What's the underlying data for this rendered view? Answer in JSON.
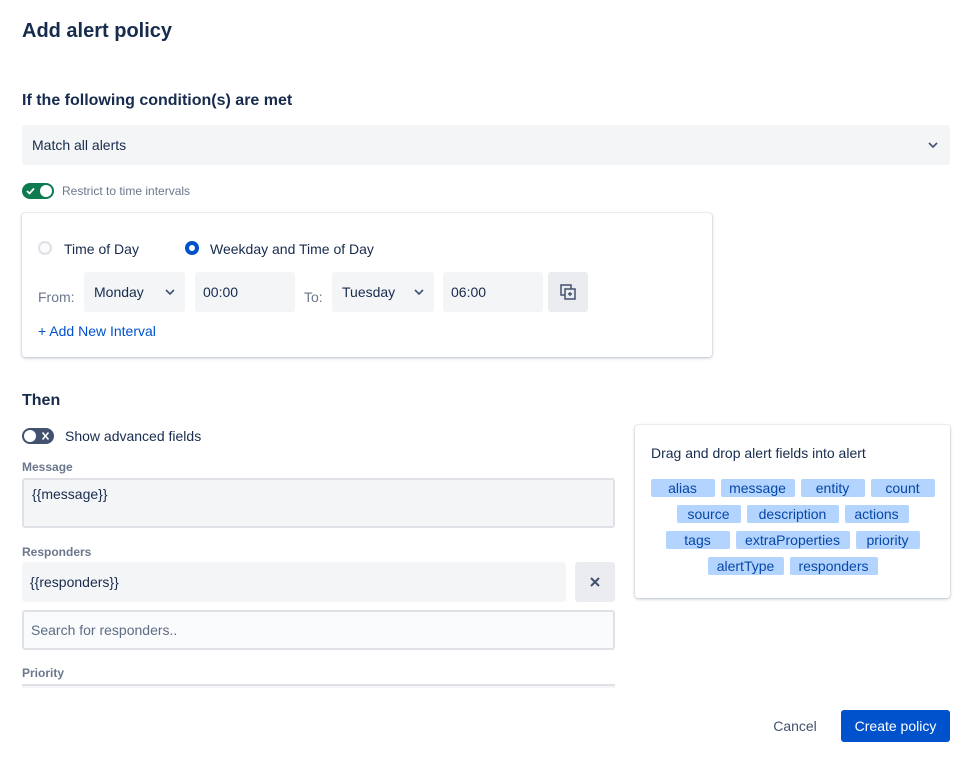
{
  "page": {
    "title": "Add alert policy"
  },
  "conditions": {
    "heading": "If the following condition(s) are met",
    "match_value": "Match all alerts",
    "restrict_toggle": {
      "label": "Restrict to time intervals",
      "on": true
    }
  },
  "interval": {
    "options": [
      {
        "label": "Time of Day",
        "selected": false
      },
      {
        "label": "Weekday and Time of Day",
        "selected": true
      }
    ],
    "from_label": "From:",
    "from_day": "Monday",
    "from_time": "00:00",
    "to_label": "To:",
    "to_day": "Tuesday",
    "to_time": "06:00",
    "add_link": "+ Add New Interval"
  },
  "then": {
    "heading": "Then",
    "advanced_toggle": {
      "label": "Show advanced fields",
      "on": false
    },
    "message_label": "Message",
    "message_value": "{{message}}",
    "responders_label": "Responders",
    "responders_value": "{{responders}}",
    "search_placeholder": "Search for responders..",
    "priority_label": "Priority"
  },
  "dnd": {
    "title": "Drag and drop alert fields into alert",
    "chips": [
      "alias",
      "message",
      "entity",
      "count",
      "source",
      "description",
      "actions",
      "tags",
      "extraProperties",
      "priority",
      "alertType",
      "responders"
    ]
  },
  "footer": {
    "cancel": "Cancel",
    "create": "Create policy"
  },
  "colors": {
    "primary": "#0052cc",
    "toggle_on": "#0e7a4f",
    "toggle_off": "#42526e",
    "chip_bg": "#b3d4ff",
    "chip_text": "#0747a6"
  }
}
